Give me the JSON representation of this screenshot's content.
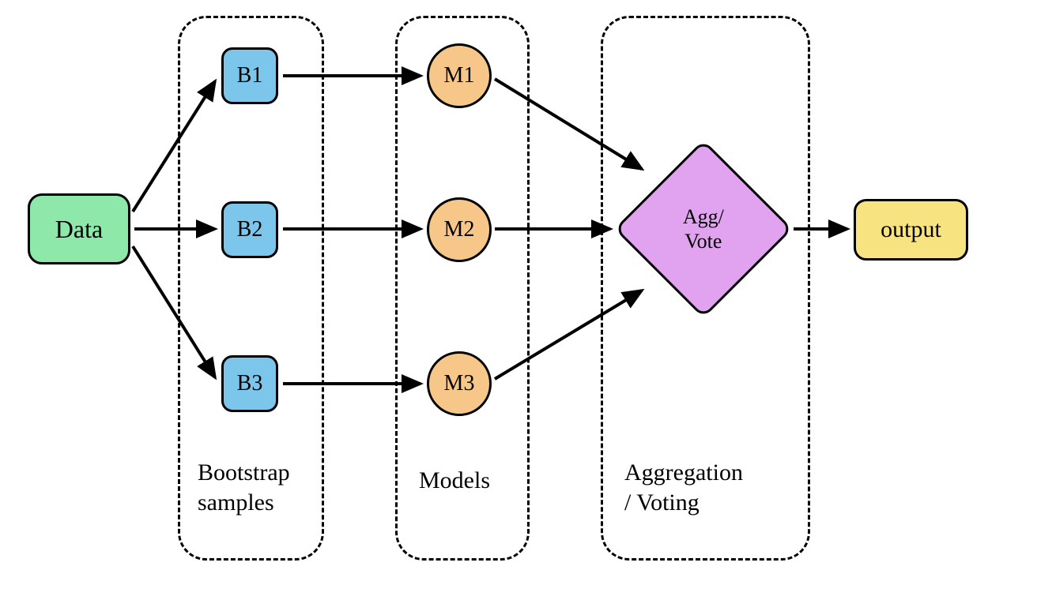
{
  "nodes": {
    "data": "Data",
    "b1": "B1",
    "b2": "B2",
    "b3": "B3",
    "m1": "M1",
    "m2": "M2",
    "m3": "M3",
    "agg_line1": "Agg/",
    "agg_line2": "Vote",
    "output": "output"
  },
  "groups": {
    "bootstrap_line1": "Bootstrap",
    "bootstrap_line2": "samples",
    "models": "Models",
    "agg_line1": "Aggregation",
    "agg_line2": "/ Voting"
  }
}
